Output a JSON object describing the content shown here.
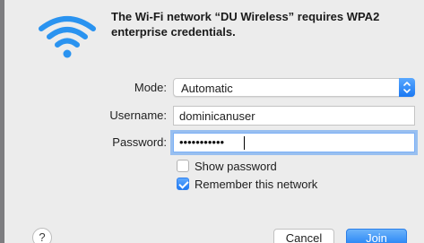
{
  "dialog": {
    "title": "The Wi-Fi network “DU Wireless” requires WPA2 enterprise credentials.",
    "icon": "wifi-icon"
  },
  "form": {
    "mode_label": "Mode:",
    "mode_value": "Automatic",
    "username_label": "Username:",
    "username_value": "dominicanuser",
    "password_label": "Password:",
    "password_masked": "•••••••••••"
  },
  "options": {
    "show_password_label": "Show password",
    "show_password_checked": false,
    "remember_label": "Remember this network",
    "remember_checked": true
  },
  "buttons": {
    "help_label": "?",
    "cancel_label": "Cancel",
    "join_label": "Join"
  },
  "colors": {
    "accent": "#1a7cf5",
    "wifi_icon": "#2a93f0",
    "background": "#ececec"
  }
}
